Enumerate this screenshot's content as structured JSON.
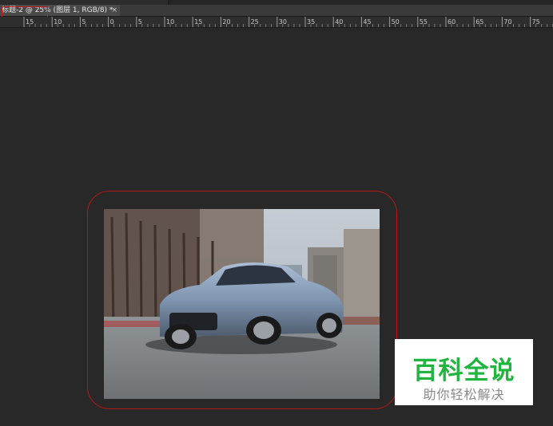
{
  "document_tab": {
    "title": "标题-2 @ 25% (图层 1, RGB/8) *",
    "close_glyph": "×"
  },
  "ruler": {
    "labels": [
      "15",
      "10",
      "5",
      "0",
      "5",
      "10",
      "15",
      "20",
      "25",
      "30",
      "35",
      "40",
      "45",
      "50",
      "55",
      "60",
      "65",
      "70",
      "75"
    ]
  },
  "photo": {
    "subject": "car-photo"
  },
  "watermark": {
    "title": "百科全说",
    "subtitle": "助你轻松解决",
    "title_color": "#1fb53e"
  },
  "colors": {
    "workspace": "#282828",
    "annotation_red": "#cc1b1b"
  }
}
